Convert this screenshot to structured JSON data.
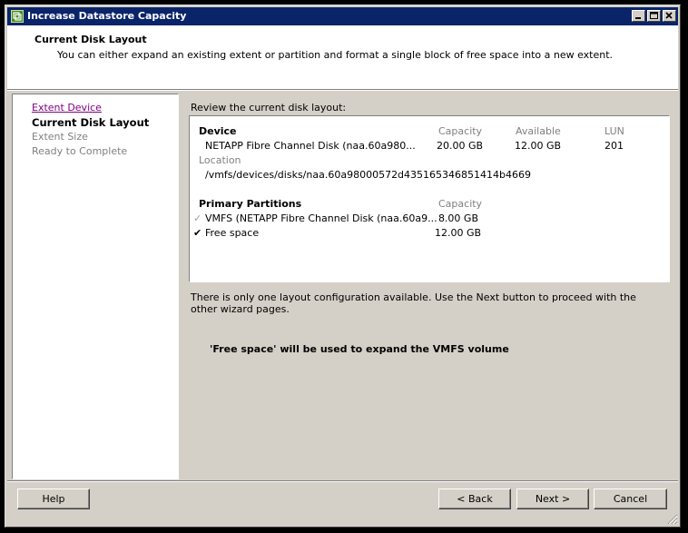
{
  "window": {
    "title": "Increase Datastore Capacity",
    "controls": [
      "minimize",
      "maximize",
      "close"
    ]
  },
  "header": {
    "title": "Current Disk Layout",
    "description": "You can either expand an existing extent or partition and format a single block of free space into a new extent."
  },
  "nav": {
    "items": [
      {
        "label": "Extent Device",
        "state": "link"
      },
      {
        "label": "Current Disk Layout",
        "state": "current"
      },
      {
        "label": "Extent Size",
        "state": "disabled"
      },
      {
        "label": "Ready to Complete",
        "state": "disabled"
      }
    ]
  },
  "main": {
    "review_label": "Review the current disk layout:",
    "device": {
      "header": "Device",
      "capacity_header": "Capacity",
      "available_header": "Available",
      "lun_header": "LUN",
      "name": "NETAPP Fibre Channel Disk (naa.60a980...",
      "capacity": "20.00 GB",
      "available": "12.00 GB",
      "lun": "201",
      "location_label": "Location",
      "location": "/vmfs/devices/disks/naa.60a98000572d435165346851414b4669"
    },
    "partitions": {
      "header": "Primary Partitions",
      "capacity_header": "Capacity",
      "rows": [
        {
          "check": "✓",
          "name": "VMFS (NETAPP Fibre Channel Disk (naa.60a9...",
          "capacity": "8.00 GB",
          "checked": false
        },
        {
          "check": "✔",
          "name": "Free space",
          "capacity": "12.00 GB",
          "checked": true
        }
      ]
    },
    "note": "There is only one layout configuration available. Use the Next button to proceed with the other wizard pages.",
    "expand_message": "'Free space' will be used to expand the VMFS volume"
  },
  "buttons": {
    "help": "Help",
    "back": "< Back",
    "next": "Next >",
    "cancel": "Cancel"
  },
  "colors": {
    "titlebar": "#0a246a",
    "visited_link": "#800080",
    "disabled_text": "#808080"
  }
}
